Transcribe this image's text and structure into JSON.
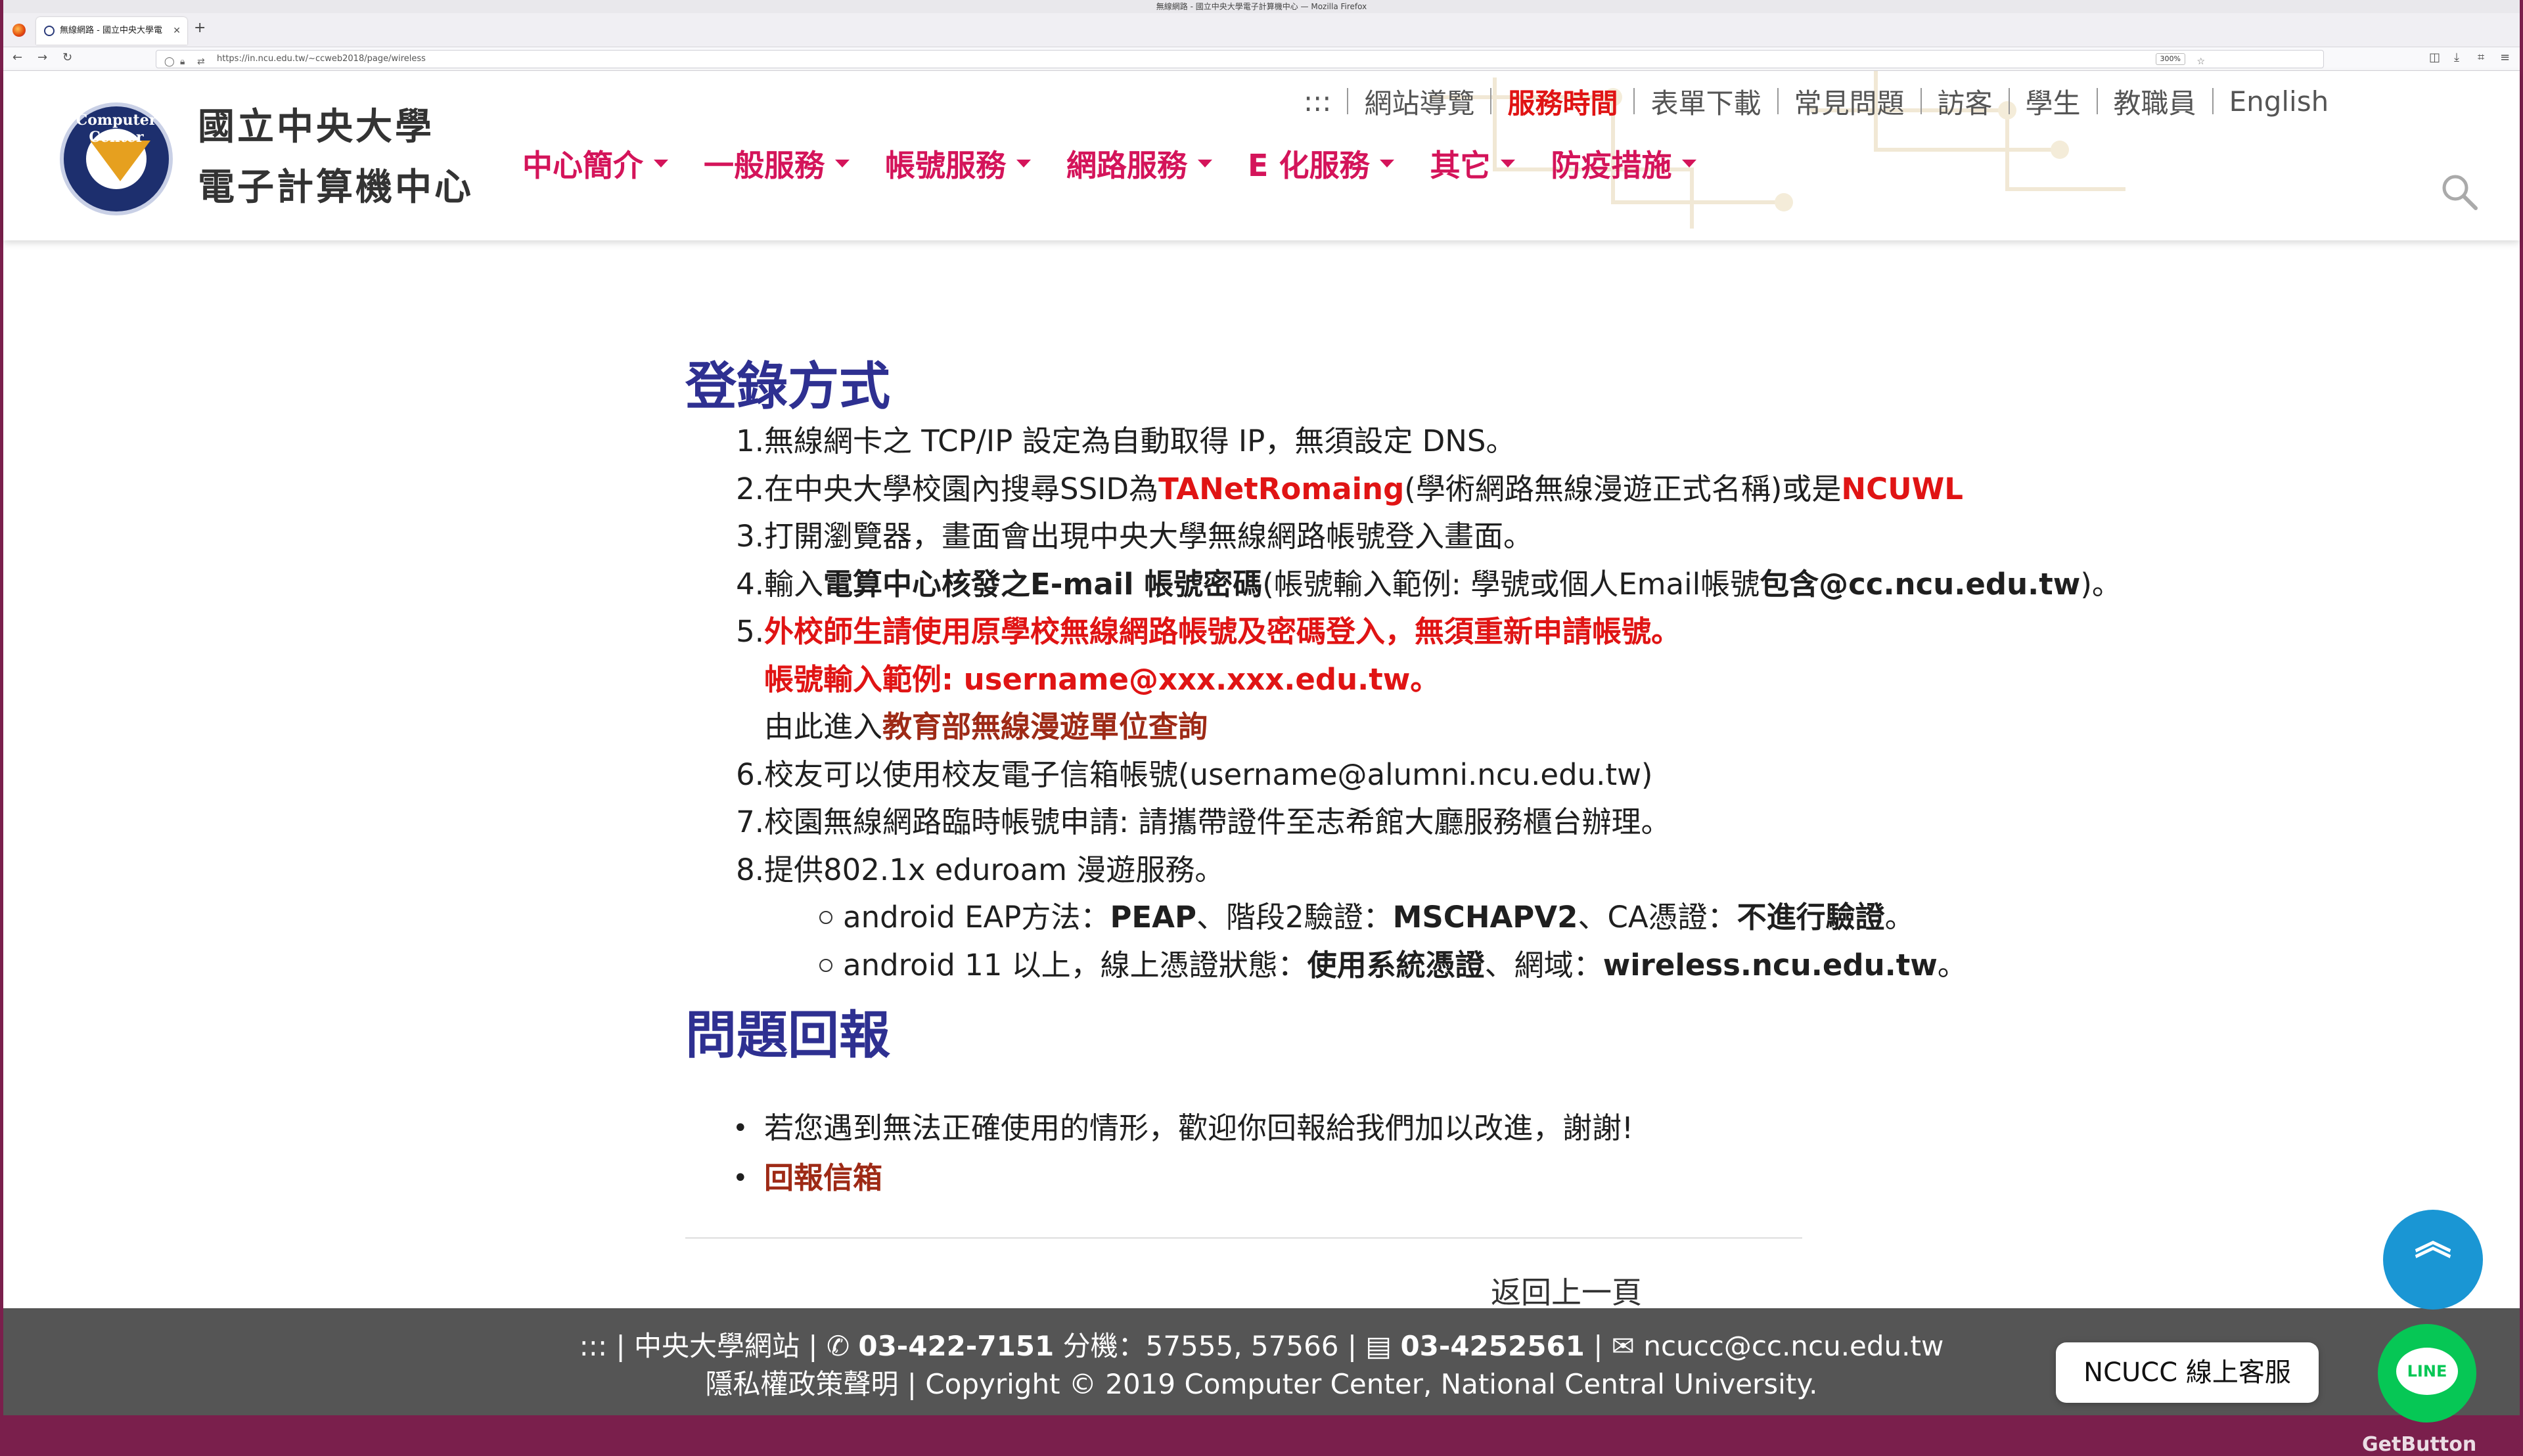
{
  "browser": {
    "window_title": "無線網路 - 國立中央大學電子計算機中心 — Mozilla Firefox",
    "tab_title": "無線網路 - 國立中央大學電",
    "url": "https://in.ncu.edu.tw/~ccweb2018/page/wireless",
    "zoom": "300%"
  },
  "site": {
    "title_line1": "國立中央大學",
    "title_line2": "電子計算機中心",
    "logo_text": "Computer Center",
    "top_nav": [
      {
        "label": ":::"
      },
      {
        "label": "網站導覽"
      },
      {
        "label": "服務時間",
        "active": true
      },
      {
        "label": "表單下載"
      },
      {
        "label": "常見問題"
      },
      {
        "label": "訪客"
      },
      {
        "label": "學生"
      },
      {
        "label": "教職員"
      },
      {
        "label": "English"
      }
    ],
    "main_nav": [
      {
        "label": "中心簡介"
      },
      {
        "label": "一般服務"
      },
      {
        "label": "帳號服務"
      },
      {
        "label": "網路服務"
      },
      {
        "label": "E 化服務"
      },
      {
        "label": "其它"
      },
      {
        "label": "防疫措施"
      }
    ]
  },
  "content": {
    "login_heading": "登錄方式",
    "steps": [
      {
        "num": "1.",
        "parts": [
          {
            "t": "無線網卡之 TCP/IP 設定為自動取得 IP，無須設定 DNS。"
          }
        ]
      },
      {
        "num": "2.",
        "parts": [
          {
            "t": "在中央大學校園內搜尋SSID為"
          },
          {
            "t": "TANetRomaing",
            "s": "red"
          },
          {
            "t": "(學術網路無線漫遊正式名稱)或是"
          },
          {
            "t": "NCUWL",
            "s": "red"
          }
        ]
      },
      {
        "num": "3.",
        "parts": [
          {
            "t": "打開瀏覽器，畫面會出現中央大學無線網路帳號登入畫面。"
          }
        ]
      },
      {
        "num": "4.",
        "parts": [
          {
            "t": "輸入"
          },
          {
            "t": "電算中心核發之E-mail 帳號密碼",
            "s": "bold"
          },
          {
            "t": "(帳號輸入範例: 學號或個人Email帳號"
          },
          {
            "t": "包含@cc.ncu.edu.tw",
            "s": "bold"
          },
          {
            "t": ")。"
          }
        ]
      },
      {
        "num": "5.",
        "parts": [
          {
            "t": "外校師生請使用原學校無線網路帳號及密碼登入，無須重新申請帳號。",
            "s": "red"
          }
        ]
      },
      {
        "num": "",
        "parts": [
          {
            "t": "帳號輸入範例: username@xxx.xxx.edu.tw。",
            "s": "red"
          }
        ]
      },
      {
        "num": "",
        "parts": [
          {
            "t": "由此進入"
          },
          {
            "t": "教育部無線漫遊單位查詢",
            "s": "brown"
          }
        ]
      },
      {
        "num": "6.",
        "parts": [
          {
            "t": "校友可以使用校友電子信箱帳號(username@alumni.ncu.edu.tw)"
          }
        ]
      },
      {
        "num": "7.",
        "parts": [
          {
            "t": "校園無線網路臨時帳號申請: 請攜帶證件至志希館大廳服務櫃台辦理。"
          }
        ]
      },
      {
        "num": "8.",
        "parts": [
          {
            "t": "提供802.1x eduroam 漫遊服務。"
          }
        ]
      }
    ],
    "sub_steps": [
      {
        "parts": [
          {
            "t": "android EAP方法："
          },
          {
            "t": "PEAP",
            "s": "bold"
          },
          {
            "t": "、階段2驗證："
          },
          {
            "t": "MSCHAPV2",
            "s": "bold"
          },
          {
            "t": "、CA憑證："
          },
          {
            "t": "不進行驗證",
            "s": "bold"
          },
          {
            "t": "。"
          }
        ]
      },
      {
        "parts": [
          {
            "t": "android 11 以上，線上憑證狀態："
          },
          {
            "t": "使用系統憑證",
            "s": "bold"
          },
          {
            "t": "、網域："
          },
          {
            "t": "wireless.ncu.edu.tw",
            "s": "bold"
          },
          {
            "t": "。"
          }
        ]
      }
    ],
    "report_heading": "問題回報",
    "report_items": [
      {
        "parts": [
          {
            "t": "若您遇到無法正確使用的情形，歡迎你回報給我們加以改進，謝謝!"
          }
        ]
      },
      {
        "parts": [
          {
            "t": "回報信箱",
            "s": "brown"
          }
        ]
      }
    ],
    "back_link": "返回上一頁"
  },
  "floating": {
    "scroll_top_icon": "double-chevron-up-icon",
    "line_bubble": "NCUCC 線上客服",
    "line_label": "LINE",
    "getbutton": "GetButton"
  },
  "footer": {
    "line1_prefix": "::: | 中央大學網站 |",
    "phone": "03-422-7151",
    "ext_label": "分機：57555, 57566",
    "fax": "03-4252561",
    "email": "ncucc@cc.ncu.edu.tw",
    "line2": "隱私權政策聲明 | Copyright © 2019 Computer Center, National Central University."
  },
  "colors": {
    "accent_menu": "#d4145a",
    "heading": "#2e3091",
    "alert_red": "#e01414",
    "link_brown": "#9e2a16",
    "footer_bg": "#555555"
  }
}
